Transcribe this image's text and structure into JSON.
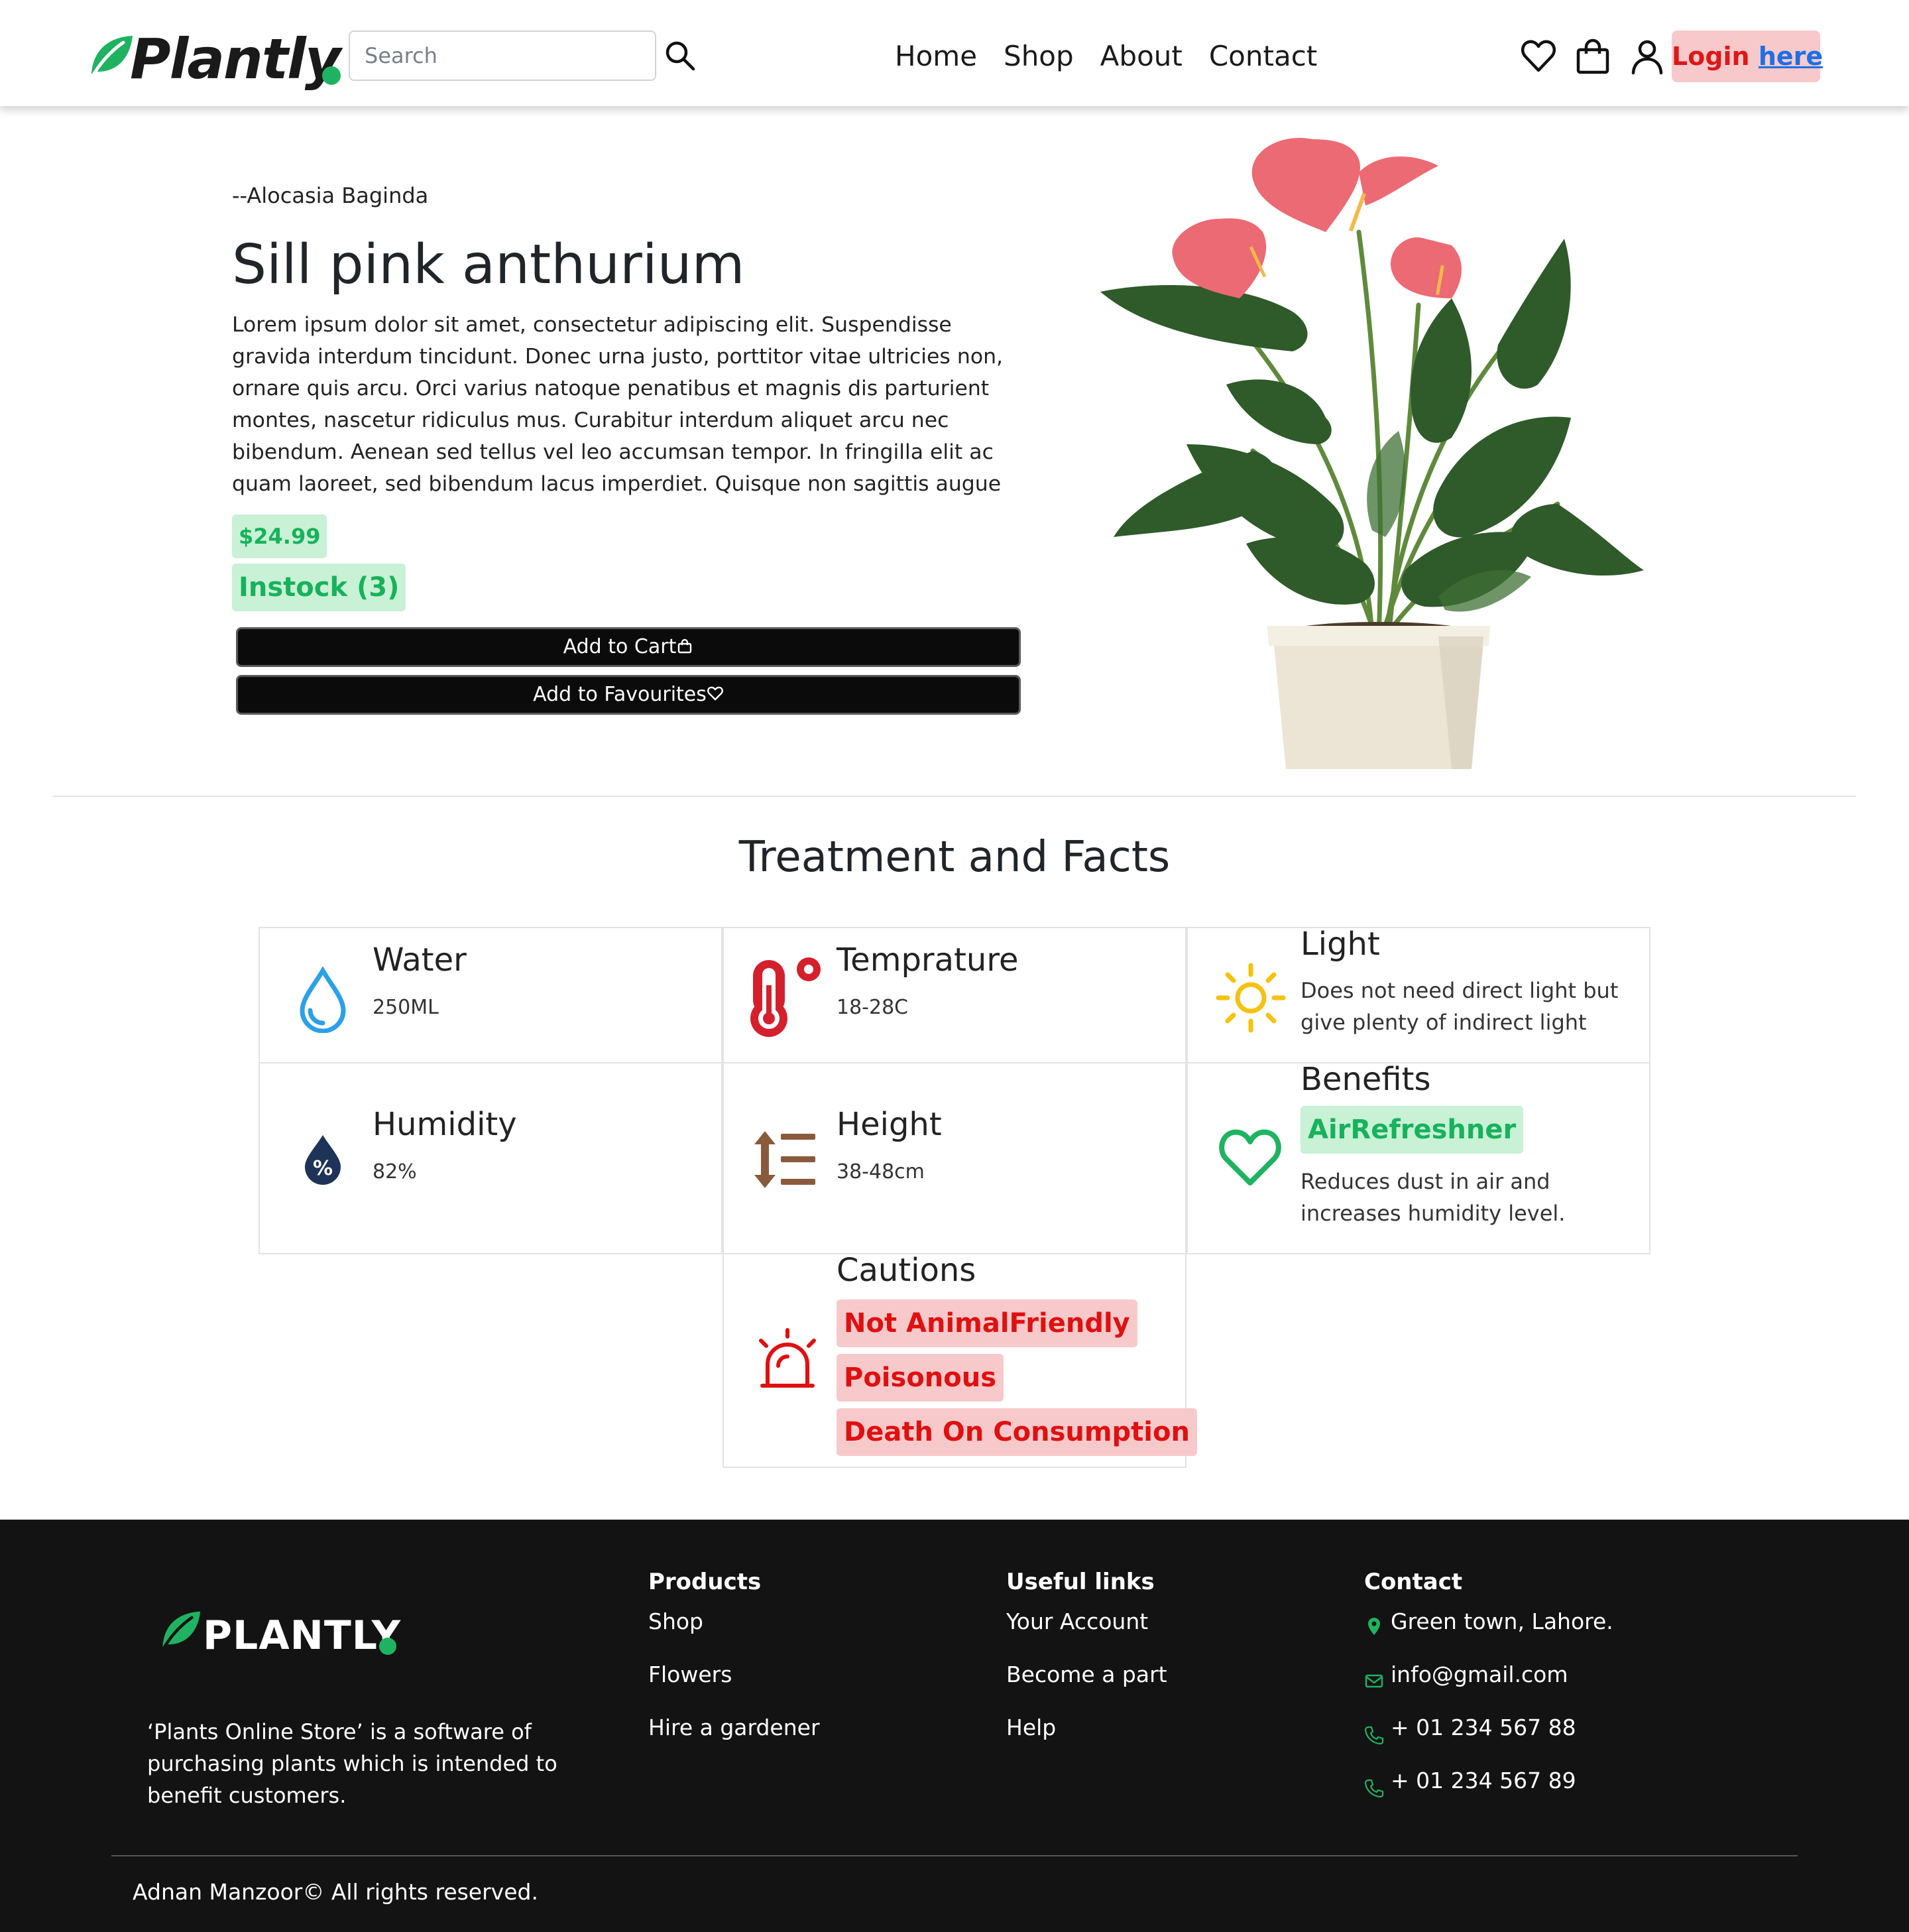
{
  "brand": {
    "name": "Plantly",
    "accent": "#1fb361"
  },
  "header": {
    "search": {
      "placeholder": "Search",
      "value": ""
    },
    "nav": [
      "Home",
      "Shop",
      "About",
      "Contact"
    ],
    "login": {
      "word": "Login",
      "link": "here"
    }
  },
  "product": {
    "kicker": "--Alocasia Baginda",
    "title": "Sill pink anthurium",
    "description": "Lorem ipsum dolor sit amet, consectetur adipiscing elit. Suspendisse gravida interdum tincidunt. Donec urna justo, porttitor vitae ultricies non, ornare quis arcu. Orci varius natoque penatibus et magnis dis parturient montes, nascetur ridiculus mus. Curabitur interdum aliquet arcu nec bibendum. Aenean sed tellus vel leo accumsan tempor. In fringilla elit ac quam laoreet, sed bibendum lacus imperdiet. Quisque non sagittis augue",
    "price": "$24.99",
    "stock": "Instock (3)",
    "add_to_cart": "Add to Cart",
    "add_to_favourites": "Add to Favourites"
  },
  "facts": {
    "title": "Treatment and Facts",
    "water": {
      "label": "Water",
      "value": "250ML"
    },
    "temperature": {
      "label": "Temprature",
      "value": "18-28C"
    },
    "light": {
      "label": "Light",
      "value": "Does not need direct light but give plenty of indirect light"
    },
    "humidity": {
      "label": "Humidity",
      "value": "82%"
    },
    "height": {
      "label": "Height",
      "value": "38-48cm"
    },
    "benefits": {
      "label": "Benefits",
      "tag": "AirRefreshner",
      "text": "Reduces dust in air and increases humidity level."
    },
    "cautions": {
      "label": "Cautions",
      "tags": [
        "Not AnimalFriendly",
        "Poisonous",
        "Death On Consumption"
      ]
    }
  },
  "footer": {
    "logo": "PLANTLY",
    "about": "‘Plants Online Store’ is a software of purchasing plants which is intended to benefit customers.",
    "columns": [
      {
        "title": "Products",
        "links": [
          "Shop",
          "Flowers",
          "Hire a gardener"
        ]
      },
      {
        "title": "Useful links",
        "links": [
          "Your Account",
          "Become a part",
          "Help"
        ]
      },
      {
        "title": "Contact",
        "links": [
          "Green town, Lahore.",
          "info@gmail.com",
          "+ 01 234 567 88",
          "+ 01 234 567 89"
        ]
      }
    ],
    "copyright": "Adnan Manzoor© All rights reserved."
  }
}
